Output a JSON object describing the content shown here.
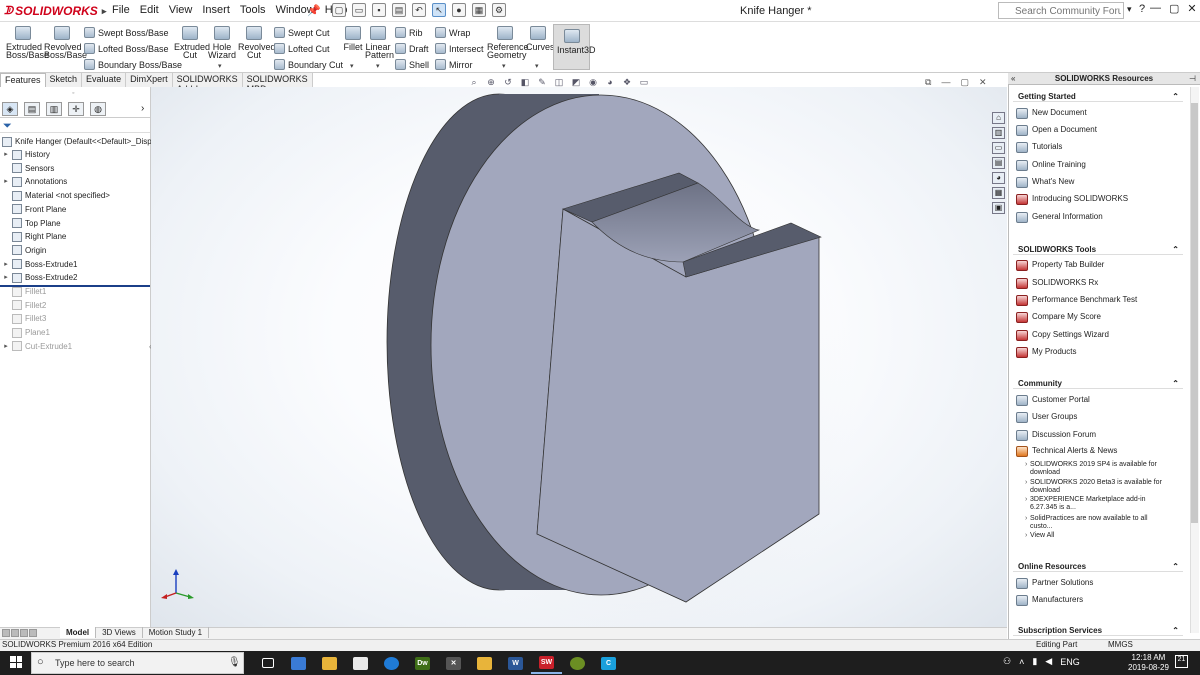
{
  "app": {
    "logo_text": "SOLIDWORKS",
    "document_title": "Knife Hanger *",
    "menu": [
      "File",
      "Edit",
      "View",
      "Insert",
      "Tools",
      "Window",
      "Help"
    ],
    "search_placeholder": "Search Community Forum",
    "help_glyph": "?"
  },
  "ribbon": {
    "extruded_boss": [
      "Extruded",
      "Boss/Base"
    ],
    "revolved_boss": [
      "Revolved",
      "Boss/Base"
    ],
    "swept_boss": "Swept Boss/Base",
    "lofted_boss": "Lofted Boss/Base",
    "boundary_boss": "Boundary Boss/Base",
    "extruded_cut": [
      "Extruded",
      "Cut"
    ],
    "hole_wizard": [
      "Hole",
      "Wizard"
    ],
    "revolved_cut": [
      "Revolved",
      "Cut"
    ],
    "swept_cut": "Swept Cut",
    "lofted_cut": "Lofted Cut",
    "boundary_cut": "Boundary Cut",
    "fillet": "Fillet",
    "linear_pattern": [
      "Linear",
      "Pattern"
    ],
    "rib": "Rib",
    "draft": "Draft",
    "shell": "Shell",
    "wrap": "Wrap",
    "intersect": "Intersect",
    "mirror": "Mirror",
    "reference_geometry": [
      "Reference",
      "Geometry"
    ],
    "curves": "Curves",
    "instant3d": "Instant3D"
  },
  "command_tabs": [
    "Features",
    "Sketch",
    "Evaluate",
    "DimXpert",
    "SOLIDWORKS Add-Ins",
    "SOLIDWORKS MBD"
  ],
  "feature_tree": {
    "root": "Knife Hanger  (Default<<Default>_Displa",
    "items": [
      {
        "label": "History",
        "expandable": true,
        "suppressed": false
      },
      {
        "label": "Sensors",
        "expandable": false,
        "suppressed": false
      },
      {
        "label": "Annotations",
        "expandable": true,
        "suppressed": false
      },
      {
        "label": "Material <not specified>",
        "expandable": false,
        "suppressed": false
      },
      {
        "label": "Front Plane",
        "expandable": false,
        "suppressed": false
      },
      {
        "label": "Top Plane",
        "expandable": false,
        "suppressed": false
      },
      {
        "label": "Right Plane",
        "expandable": false,
        "suppressed": false
      },
      {
        "label": "Origin",
        "expandable": false,
        "suppressed": false
      },
      {
        "label": "Boss-Extrude1",
        "expandable": true,
        "suppressed": false
      },
      {
        "label": "Boss-Extrude2",
        "expandable": true,
        "suppressed": false
      },
      {
        "label": "Fillet1",
        "expandable": false,
        "suppressed": true
      },
      {
        "label": "Fillet2",
        "expandable": false,
        "suppressed": true
      },
      {
        "label": "Fillet3",
        "expandable": false,
        "suppressed": true
      },
      {
        "label": "Plane1",
        "expandable": false,
        "suppressed": true
      },
      {
        "label": "Cut-Extrude1",
        "expandable": true,
        "suppressed": true
      }
    ]
  },
  "resources": {
    "title": "SOLIDWORKS Resources",
    "getting_started": {
      "title": "Getting Started",
      "items": [
        "New Document",
        "Open a Document",
        "Tutorials",
        "Online Training",
        "What's New",
        "Introducing SOLIDWORKS",
        "General Information"
      ]
    },
    "tools": {
      "title": "SOLIDWORKS Tools",
      "items": [
        "Property Tab Builder",
        "SOLIDWORKS Rx",
        "Performance Benchmark Test",
        "Compare My Score",
        "Copy Settings Wizard",
        "My Products"
      ]
    },
    "community": {
      "title": "Community",
      "items": [
        "Customer Portal",
        "User Groups",
        "Discussion Forum",
        "Technical Alerts & News"
      ],
      "news": [
        "SOLIDWORKS 2019 SP4 is available for download",
        "SOLIDWORKS 2020 Beta3 is available for download",
        "3DEXPERIENCE Marketplace add-in 6.27.345 is a...",
        "SolidPractices are now available to all custo..."
      ],
      "view_all": "View All"
    },
    "online": {
      "title": "Online Resources",
      "items": [
        "Partner Solutions",
        "Manufacturers"
      ]
    },
    "subscription": {
      "title": "Subscription Services"
    }
  },
  "bottom_tabs": [
    "Model",
    "3D Views",
    "Motion Study 1"
  ],
  "status": {
    "edition": "SOLIDWORKS Premium 2016 x64 Edition",
    "mode": "Editing Part",
    "units": "MMGS"
  },
  "taskbar": {
    "search_placeholder": "Type here to search",
    "lang": "ENG",
    "time": "12:18 AM",
    "date": "2019-08-29",
    "notification_count": "21"
  },
  "colors": {
    "model_face": "#a2a7bd",
    "model_dark": "#575c6c",
    "brand_red": "#d0021b"
  }
}
